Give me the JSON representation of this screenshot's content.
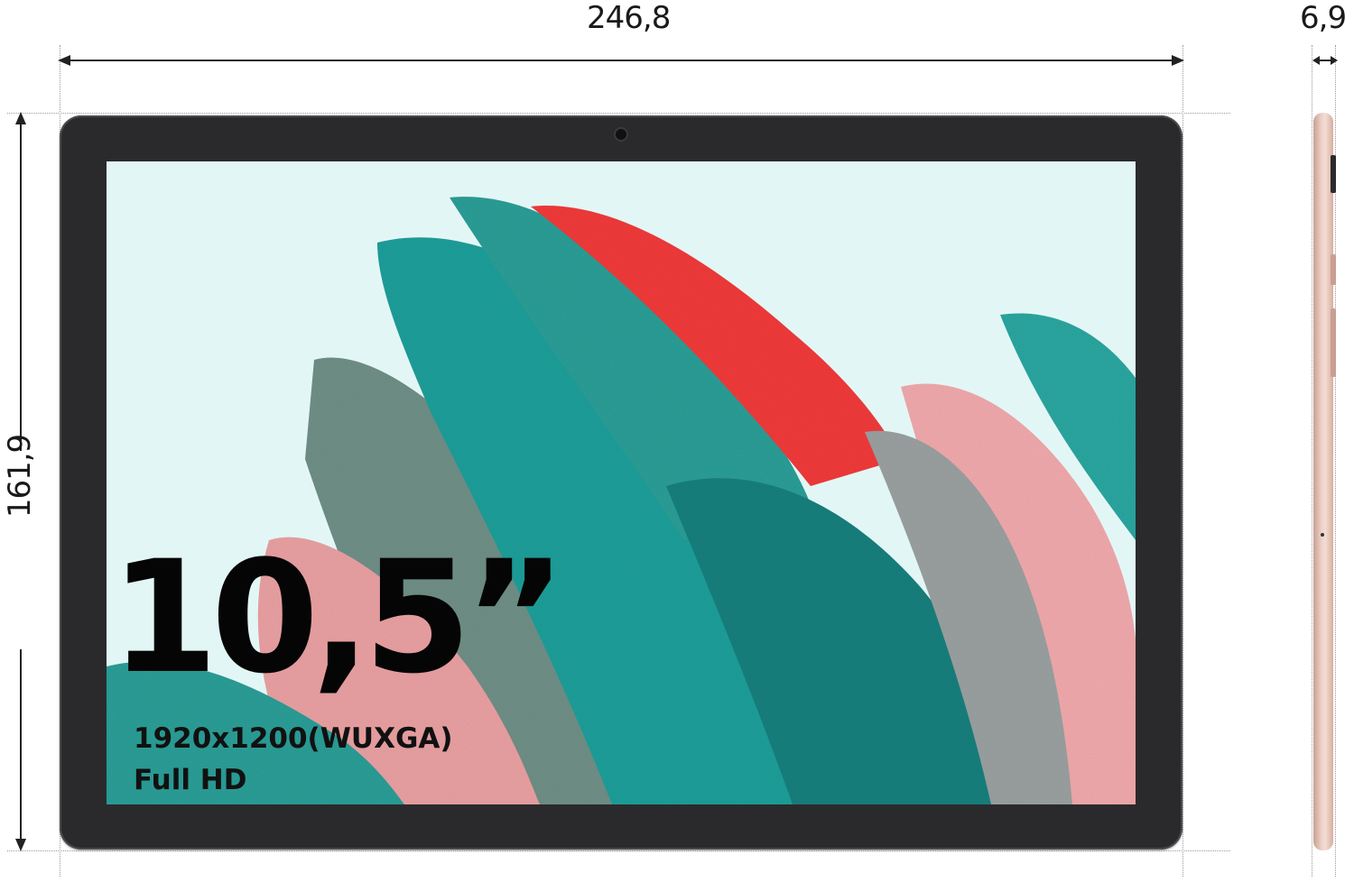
{
  "dimensions": {
    "width": "246,8",
    "height": "161,9",
    "thickness": "6,9"
  },
  "screen": {
    "size": "10,5”",
    "resolution": "1920x1200(WUXGA)",
    "label": "Full HD"
  },
  "colors": {
    "bezel": "#2a2a2c",
    "screen_bg": "#e3f6f6",
    "teal": "#1f9e9a",
    "red": "#f03a3a",
    "pink": "#f0a9ac",
    "gray_green": "#6f8f86",
    "side_rose_gold": "#e8c8bc"
  }
}
